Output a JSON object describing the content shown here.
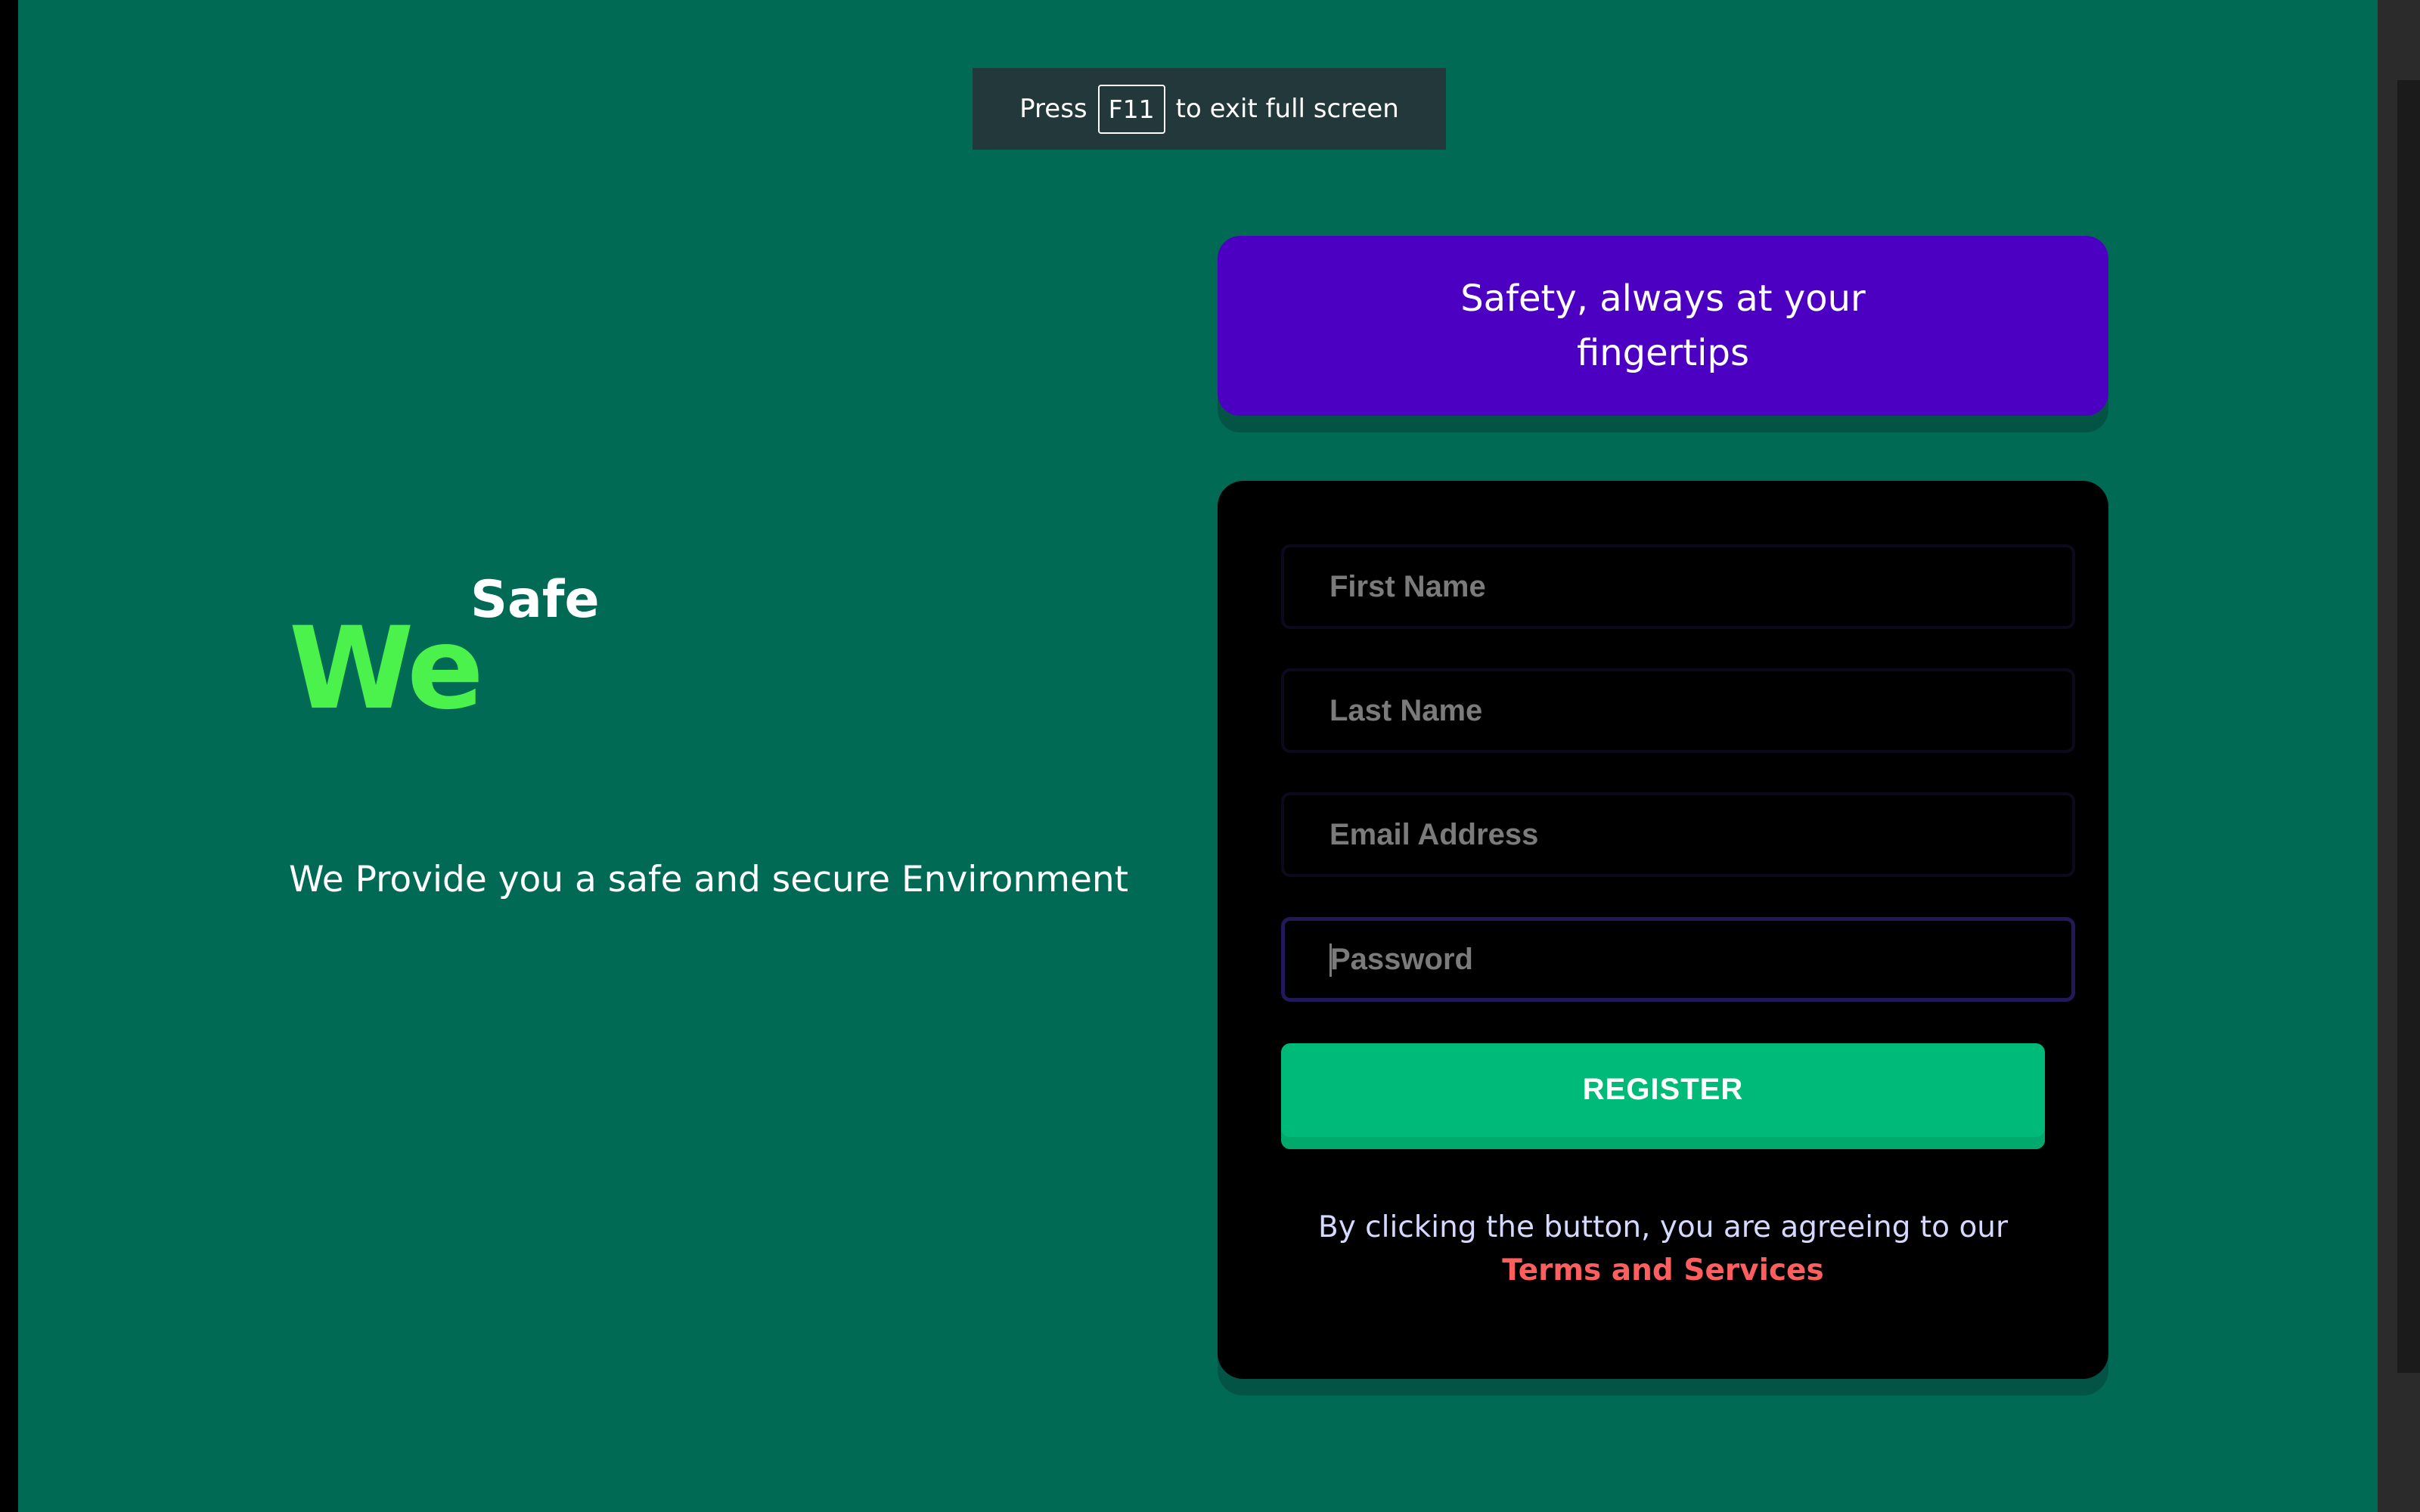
{
  "banner": {
    "press": "Press",
    "key": "F11",
    "message": "to exit full screen"
  },
  "brand": {
    "we": "We",
    "safe": "Safe",
    "tagline": "We Provide you a safe and secure Environment"
  },
  "hero": {
    "line1": "Safety, always at your",
    "line2": "fingertips"
  },
  "form": {
    "first_name_placeholder": "First Name",
    "last_name_placeholder": "Last Name",
    "email_placeholder": "Email Address",
    "password_placeholder": "Password",
    "first_name_value": "",
    "last_name_value": "",
    "email_value": "",
    "password_value": "",
    "register_label": "REGISTER",
    "disclaimer_text": "By clicking the button, you are agreeing to our",
    "terms_label": "Terms and Services"
  },
  "colors": {
    "background": "#006A55",
    "hero_card": "#4B00C2",
    "form_card": "#000000",
    "brand_green": "#4BF24B",
    "register_button": "#00BA7A",
    "terms_link": "#FF5E5E",
    "banner": "#22383A"
  },
  "state": {
    "focused_field": "password"
  }
}
